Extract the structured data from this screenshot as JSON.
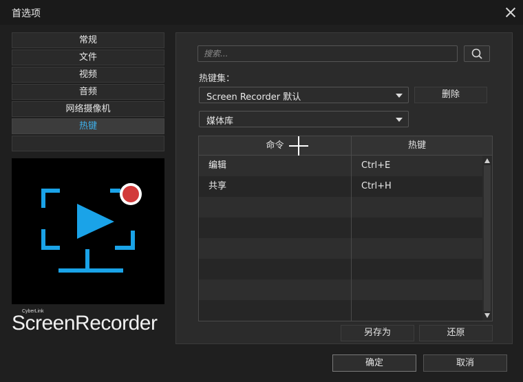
{
  "window": {
    "title": "首选项"
  },
  "nav": {
    "items": [
      {
        "label": "常规"
      },
      {
        "label": "文件"
      },
      {
        "label": "视频"
      },
      {
        "label": "音频"
      },
      {
        "label": "网络摄像机"
      },
      {
        "label": "热键",
        "active": true
      }
    ]
  },
  "brand": {
    "small": "CyberLink",
    "name": "ScreenRecorder"
  },
  "search": {
    "placeholder": "搜索..."
  },
  "hotkeys": {
    "keyset_label": "热键集：",
    "keyset_value": "Screen Recorder 默认",
    "delete_label": "删除",
    "category_value": "媒体库",
    "columns": [
      "命令",
      "热键"
    ],
    "rows": [
      {
        "command": "编辑",
        "hotkey": "Ctrl+E"
      },
      {
        "command": "共享",
        "hotkey": "Ctrl+H"
      }
    ],
    "save_as_label": "另存为",
    "restore_label": "还原"
  },
  "footer": {
    "ok_label": "确定",
    "cancel_label": "取消"
  },
  "colors": {
    "accent": "#3fb0ea",
    "logo_icon": "#1aa3e8",
    "record_dot": "#d23a3a"
  },
  "icons": [
    "close-icon",
    "search-icon",
    "chevron-down-icon",
    "screen-recorder-logo-icon",
    "record-icon",
    "scroll-up-icon",
    "scroll-down-icon"
  ]
}
